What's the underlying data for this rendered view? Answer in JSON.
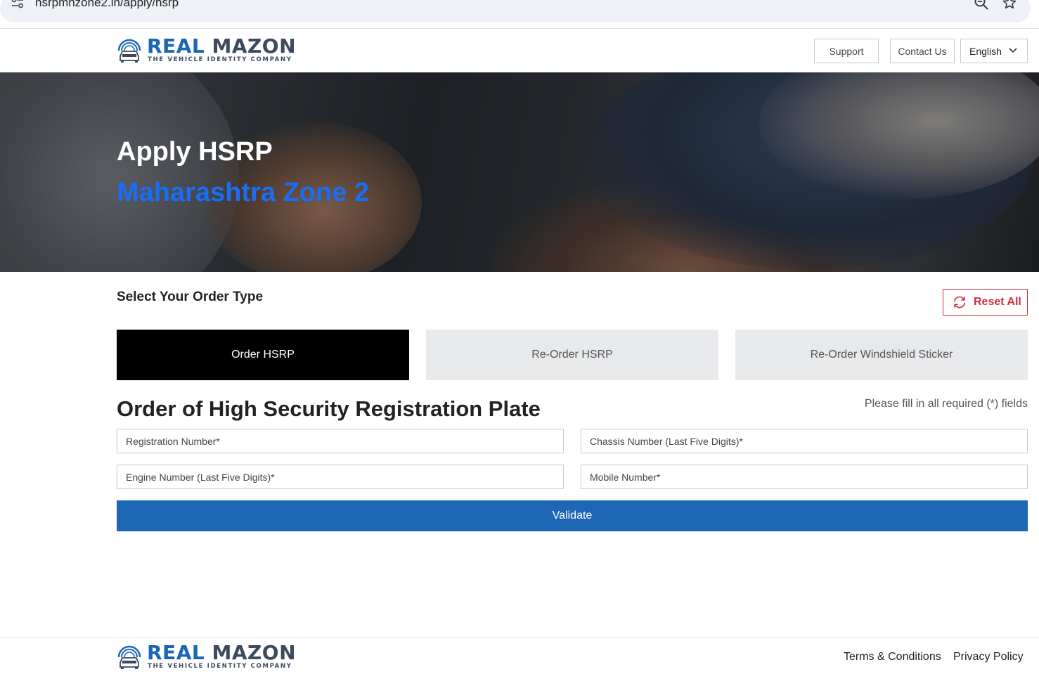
{
  "browser": {
    "url": "hsrpmhzone2.in/apply/hsrp",
    "icons": [
      "tune-icon",
      "zoom-icon",
      "star-icon"
    ]
  },
  "header": {
    "logo": {
      "word_primary": "REAL",
      "word_secondary": "MAZON",
      "tagline": "THE VEHICLE IDENTITY COMPANY"
    },
    "support_label": "Support",
    "contact_label": "Contact Us",
    "language": {
      "selected": "English"
    }
  },
  "hero": {
    "title": "Apply HSRP",
    "subtitle": "Maharashtra Zone 2"
  },
  "order_type": {
    "label": "Select Your Order Type",
    "reset_label": "Reset All",
    "tabs": [
      {
        "label": "Order HSRP",
        "active": true
      },
      {
        "label": "Re-Order HSRP",
        "active": false
      },
      {
        "label": "Re-Order Windshield Sticker",
        "active": false
      }
    ]
  },
  "form": {
    "title": "Order of High Security Registration Plate",
    "required_note": "Please fill in all required (*) fields",
    "fields": {
      "registration": {
        "placeholder": "Registration Number*",
        "value": ""
      },
      "chassis": {
        "placeholder": "Chassis Number (Last Five Digits)*",
        "value": ""
      },
      "engine": {
        "placeholder": "Engine Number (Last Five Digits)*",
        "value": ""
      },
      "mobile": {
        "placeholder": "Mobile Number*",
        "value": ""
      }
    },
    "validate_label": "Validate"
  },
  "footer": {
    "logo": {
      "word_primary": "REAL",
      "word_secondary": "MAZON",
      "tagline": "THE VEHICLE IDENTITY COMPANY"
    },
    "terms_label": "Terms & Conditions",
    "privacy_label": "Privacy Policy"
  },
  "colors": {
    "brand_blue": "#1a66b3",
    "hero_accent": "#1a6ef5",
    "reset_red": "#d62b3a",
    "active_tab": "#000000",
    "inactive_tab": "#e8e9eb",
    "validate_bg": "#1c66b3"
  }
}
